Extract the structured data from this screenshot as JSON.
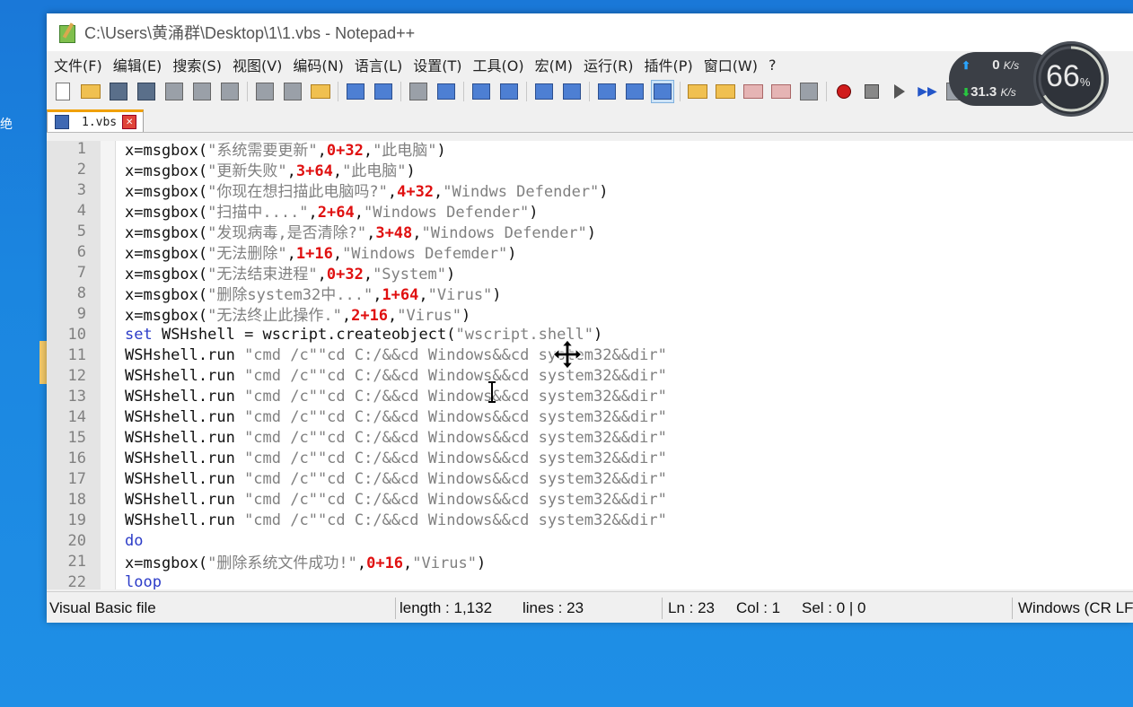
{
  "window": {
    "title": "C:\\Users\\黄涌群\\Desktop\\1\\1.vbs - Notepad++"
  },
  "menu": [
    "文件(F)",
    "编辑(E)",
    "搜索(S)",
    "视图(V)",
    "编码(N)",
    "语言(L)",
    "设置(T)",
    "工具(O)",
    "宏(M)",
    "运行(R)",
    "插件(P)",
    "窗口(W)",
    "?"
  ],
  "toolbar_icons": [
    "new-file-icon",
    "open-file-icon",
    "save-icon",
    "save-all-icon",
    "close-icon",
    "close-all-icon",
    "print-icon",
    "cut-icon",
    "copy-icon",
    "paste-icon",
    "undo-icon",
    "redo-icon",
    "find-icon",
    "replace-icon",
    "zoom-in-icon",
    "zoom-out-icon",
    "sync-vertical-icon",
    "sync-horizontal-icon",
    "word-wrap-icon",
    "show-all-chars-icon",
    "indent-guide-icon",
    "user-language-icon",
    "document-map-icon",
    "function-list-icon",
    "folder-as-workspace-icon",
    "monitoring-icon",
    "record-macro-icon",
    "stop-record-icon",
    "play-macro-icon",
    "run-macro-multiple-icon",
    "save-macro-icon"
  ],
  "tab": {
    "label": "1.vbs"
  },
  "editor": {
    "lines": [
      {
        "n": "1",
        "tokens": [
          {
            "t": "plain",
            "v": "x=msgbox("
          },
          {
            "t": "str",
            "v": "\"系统需要更新\""
          },
          {
            "t": "plain",
            "v": ","
          },
          {
            "t": "num",
            "v": "0+32"
          },
          {
            "t": "plain",
            "v": ","
          },
          {
            "t": "str",
            "v": "\"此电脑\""
          },
          {
            "t": "plain",
            "v": ")"
          }
        ]
      },
      {
        "n": "2",
        "tokens": [
          {
            "t": "plain",
            "v": "x=msgbox("
          },
          {
            "t": "str",
            "v": "\"更新失败\""
          },
          {
            "t": "plain",
            "v": ","
          },
          {
            "t": "num",
            "v": "3+64"
          },
          {
            "t": "plain",
            "v": ","
          },
          {
            "t": "str",
            "v": "\"此电脑\""
          },
          {
            "t": "plain",
            "v": ")"
          }
        ]
      },
      {
        "n": "3",
        "tokens": [
          {
            "t": "plain",
            "v": "x=msgbox("
          },
          {
            "t": "str",
            "v": "\"你现在想扫描此电脑吗?\""
          },
          {
            "t": "plain",
            "v": ","
          },
          {
            "t": "num",
            "v": "4+32"
          },
          {
            "t": "plain",
            "v": ","
          },
          {
            "t": "str",
            "v": "\"Windws Defender\""
          },
          {
            "t": "plain",
            "v": ")"
          }
        ]
      },
      {
        "n": "4",
        "tokens": [
          {
            "t": "plain",
            "v": "x=msgbox("
          },
          {
            "t": "str",
            "v": "\"扫描中....\""
          },
          {
            "t": "plain",
            "v": ","
          },
          {
            "t": "num",
            "v": "2+64"
          },
          {
            "t": "plain",
            "v": ","
          },
          {
            "t": "str",
            "v": "\"Windows Defender\""
          },
          {
            "t": "plain",
            "v": ")"
          }
        ]
      },
      {
        "n": "5",
        "tokens": [
          {
            "t": "plain",
            "v": "x=msgbox("
          },
          {
            "t": "str",
            "v": "\"发现病毒,是否清除?\""
          },
          {
            "t": "plain",
            "v": ","
          },
          {
            "t": "num",
            "v": "3+48"
          },
          {
            "t": "plain",
            "v": ","
          },
          {
            "t": "str",
            "v": "\"Windows Defender\""
          },
          {
            "t": "plain",
            "v": ")"
          }
        ]
      },
      {
        "n": "6",
        "tokens": [
          {
            "t": "plain",
            "v": "x=msgbox("
          },
          {
            "t": "str",
            "v": "\"无法删除\""
          },
          {
            "t": "plain",
            "v": ","
          },
          {
            "t": "num",
            "v": "1+16"
          },
          {
            "t": "plain",
            "v": ","
          },
          {
            "t": "str",
            "v": "\"Windows Defemder\""
          },
          {
            "t": "plain",
            "v": ")"
          }
        ]
      },
      {
        "n": "7",
        "tokens": [
          {
            "t": "plain",
            "v": "x=msgbox("
          },
          {
            "t": "str",
            "v": "\"无法结束进程\""
          },
          {
            "t": "plain",
            "v": ","
          },
          {
            "t": "num",
            "v": "0+32"
          },
          {
            "t": "plain",
            "v": ","
          },
          {
            "t": "str",
            "v": "\"System\""
          },
          {
            "t": "plain",
            "v": ")"
          }
        ]
      },
      {
        "n": "8",
        "tokens": [
          {
            "t": "plain",
            "v": "x=msgbox("
          },
          {
            "t": "str",
            "v": "\"删除system32中...\""
          },
          {
            "t": "plain",
            "v": ","
          },
          {
            "t": "num",
            "v": "1+64"
          },
          {
            "t": "plain",
            "v": ","
          },
          {
            "t": "str",
            "v": "\"Virus\""
          },
          {
            "t": "plain",
            "v": ")"
          }
        ]
      },
      {
        "n": "9",
        "tokens": [
          {
            "t": "plain",
            "v": "x=msgbox("
          },
          {
            "t": "str",
            "v": "\"无法终止此操作.\""
          },
          {
            "t": "plain",
            "v": ","
          },
          {
            "t": "num",
            "v": "2+16"
          },
          {
            "t": "plain",
            "v": ","
          },
          {
            "t": "str",
            "v": "\"Virus\""
          },
          {
            "t": "plain",
            "v": ")"
          }
        ]
      },
      {
        "n": "10",
        "tokens": [
          {
            "t": "kw",
            "v": "set"
          },
          {
            "t": "plain",
            "v": " WSHshell = wscript.createobject("
          },
          {
            "t": "str",
            "v": "\"wscript.shell\""
          },
          {
            "t": "plain",
            "v": ")"
          }
        ]
      },
      {
        "n": "11",
        "tokens": [
          {
            "t": "plain",
            "v": "WSHshell.run "
          },
          {
            "t": "str",
            "v": "\"cmd /c\"\"cd C:/&&cd Windows&&cd system32&&dir\""
          }
        ]
      },
      {
        "n": "12",
        "tokens": [
          {
            "t": "plain",
            "v": "WSHshell.run "
          },
          {
            "t": "str",
            "v": "\"cmd /c\"\"cd C:/&&cd Windows&&cd system32&&dir\""
          }
        ]
      },
      {
        "n": "13",
        "tokens": [
          {
            "t": "plain",
            "v": "WSHshell.run "
          },
          {
            "t": "str",
            "v": "\"cmd /c\"\"cd C:/&&cd Windows&&cd system32&&dir\""
          }
        ]
      },
      {
        "n": "14",
        "tokens": [
          {
            "t": "plain",
            "v": "WSHshell.run "
          },
          {
            "t": "str",
            "v": "\"cmd /c\"\"cd C:/&&cd Windows&&cd system32&&dir\""
          }
        ]
      },
      {
        "n": "15",
        "tokens": [
          {
            "t": "plain",
            "v": "WSHshell.run "
          },
          {
            "t": "str",
            "v": "\"cmd /c\"\"cd C:/&&cd Windows&&cd system32&&dir\""
          }
        ]
      },
      {
        "n": "16",
        "tokens": [
          {
            "t": "plain",
            "v": "WSHshell.run "
          },
          {
            "t": "str",
            "v": "\"cmd /c\"\"cd C:/&&cd Windows&&cd system32&&dir\""
          }
        ]
      },
      {
        "n": "17",
        "tokens": [
          {
            "t": "plain",
            "v": "WSHshell.run "
          },
          {
            "t": "str",
            "v": "\"cmd /c\"\"cd C:/&&cd Windows&&cd system32&&dir\""
          }
        ]
      },
      {
        "n": "18",
        "tokens": [
          {
            "t": "plain",
            "v": "WSHshell.run "
          },
          {
            "t": "str",
            "v": "\"cmd /c\"\"cd C:/&&cd Windows&&cd system32&&dir\""
          }
        ]
      },
      {
        "n": "19",
        "tokens": [
          {
            "t": "plain",
            "v": "WSHshell.run "
          },
          {
            "t": "str",
            "v": "\"cmd /c\"\"cd C:/&&cd Windows&&cd system32&&dir\""
          }
        ]
      },
      {
        "n": "20",
        "tokens": [
          {
            "t": "kw",
            "v": "do"
          }
        ]
      },
      {
        "n": "21",
        "tokens": [
          {
            "t": "plain",
            "v": "x=msgbox("
          },
          {
            "t": "str",
            "v": "\"删除系统文件成功!\""
          },
          {
            "t": "plain",
            "v": ","
          },
          {
            "t": "num",
            "v": "0+16"
          },
          {
            "t": "plain",
            "v": ","
          },
          {
            "t": "str",
            "v": "\"Virus\""
          },
          {
            "t": "plain",
            "v": ")"
          }
        ]
      },
      {
        "n": "22",
        "tokens": [
          {
            "t": "kw",
            "v": "loop"
          }
        ]
      }
    ]
  },
  "status": {
    "file_type": "Visual Basic file",
    "length": "length : 1,132",
    "lines": "lines : 23",
    "ln": "Ln : 23",
    "col": "Col : 1",
    "sel": "Sel : 0 | 0",
    "eol": "Windows (CR LF)"
  },
  "net_monitor": {
    "upload_value": "0",
    "upload_unit": "K/s",
    "download_value": "31.3",
    "download_unit": "K/s",
    "percent_value": "66",
    "percent_unit": "%"
  },
  "desktop": {
    "edge_glyph": "绝"
  }
}
